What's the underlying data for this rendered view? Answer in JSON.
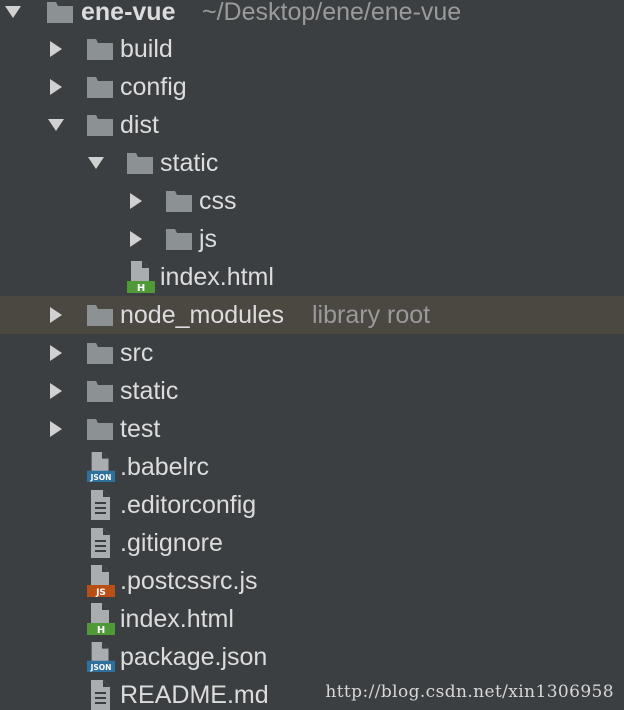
{
  "root": {
    "name": "ene-vue",
    "path": "~/Desktop/ene/ene-vue"
  },
  "items": {
    "build": "build",
    "config": "config",
    "dist": "dist",
    "dist_static": "static",
    "css": "css",
    "js": "js",
    "dist_index": "index.html",
    "node_modules": "node_modules",
    "node_modules_hint": "library root",
    "src": "src",
    "static": "static",
    "test": "test",
    "babelrc": ".babelrc",
    "editorconfig": ".editorconfig",
    "gitignore": ".gitignore",
    "postcssrc": ".postcssrc.js",
    "index": "index.html",
    "package": "package.json",
    "readme": "README.md"
  },
  "badges": {
    "html": "H",
    "json": "JSON",
    "js": "JS"
  },
  "colors": {
    "background": "#3c3f41",
    "selected_row": "#4b4842",
    "folder": "#8c9194",
    "arrow": "#d1d1d1",
    "text": "#dcdcdc",
    "muted": "#9a9a9a",
    "html_badge": "#4f9a36",
    "json_badge": "#2f6f9b",
    "js_badge": "#b84f17"
  },
  "watermark": "http://blog.csdn.net/xin1306958"
}
